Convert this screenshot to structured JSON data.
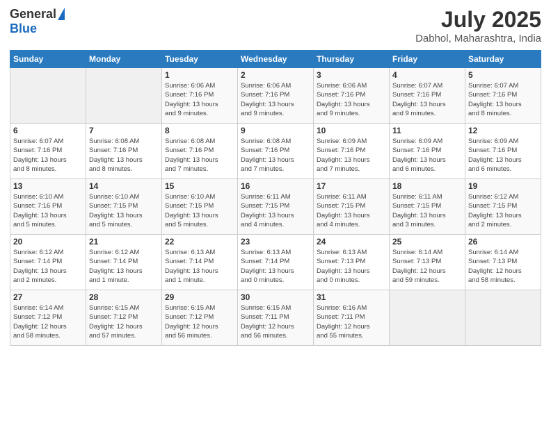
{
  "logo": {
    "general": "General",
    "blue": "Blue"
  },
  "title": "July 2025",
  "subtitle": "Dabhol, Maharashtra, India",
  "days_header": [
    "Sunday",
    "Monday",
    "Tuesday",
    "Wednesday",
    "Thursday",
    "Friday",
    "Saturday"
  ],
  "weeks": [
    [
      {
        "num": "",
        "info": ""
      },
      {
        "num": "",
        "info": ""
      },
      {
        "num": "1",
        "info": "Sunrise: 6:06 AM\nSunset: 7:16 PM\nDaylight: 13 hours\nand 9 minutes."
      },
      {
        "num": "2",
        "info": "Sunrise: 6:06 AM\nSunset: 7:16 PM\nDaylight: 13 hours\nand 9 minutes."
      },
      {
        "num": "3",
        "info": "Sunrise: 6:06 AM\nSunset: 7:16 PM\nDaylight: 13 hours\nand 9 minutes."
      },
      {
        "num": "4",
        "info": "Sunrise: 6:07 AM\nSunset: 7:16 PM\nDaylight: 13 hours\nand 9 minutes."
      },
      {
        "num": "5",
        "info": "Sunrise: 6:07 AM\nSunset: 7:16 PM\nDaylight: 13 hours\nand 8 minutes."
      }
    ],
    [
      {
        "num": "6",
        "info": "Sunrise: 6:07 AM\nSunset: 7:16 PM\nDaylight: 13 hours\nand 8 minutes."
      },
      {
        "num": "7",
        "info": "Sunrise: 6:08 AM\nSunset: 7:16 PM\nDaylight: 13 hours\nand 8 minutes."
      },
      {
        "num": "8",
        "info": "Sunrise: 6:08 AM\nSunset: 7:16 PM\nDaylight: 13 hours\nand 7 minutes."
      },
      {
        "num": "9",
        "info": "Sunrise: 6:08 AM\nSunset: 7:16 PM\nDaylight: 13 hours\nand 7 minutes."
      },
      {
        "num": "10",
        "info": "Sunrise: 6:09 AM\nSunset: 7:16 PM\nDaylight: 13 hours\nand 7 minutes."
      },
      {
        "num": "11",
        "info": "Sunrise: 6:09 AM\nSunset: 7:16 PM\nDaylight: 13 hours\nand 6 minutes."
      },
      {
        "num": "12",
        "info": "Sunrise: 6:09 AM\nSunset: 7:16 PM\nDaylight: 13 hours\nand 6 minutes."
      }
    ],
    [
      {
        "num": "13",
        "info": "Sunrise: 6:10 AM\nSunset: 7:16 PM\nDaylight: 13 hours\nand 5 minutes."
      },
      {
        "num": "14",
        "info": "Sunrise: 6:10 AM\nSunset: 7:15 PM\nDaylight: 13 hours\nand 5 minutes."
      },
      {
        "num": "15",
        "info": "Sunrise: 6:10 AM\nSunset: 7:15 PM\nDaylight: 13 hours\nand 5 minutes."
      },
      {
        "num": "16",
        "info": "Sunrise: 6:11 AM\nSunset: 7:15 PM\nDaylight: 13 hours\nand 4 minutes."
      },
      {
        "num": "17",
        "info": "Sunrise: 6:11 AM\nSunset: 7:15 PM\nDaylight: 13 hours\nand 4 minutes."
      },
      {
        "num": "18",
        "info": "Sunrise: 6:11 AM\nSunset: 7:15 PM\nDaylight: 13 hours\nand 3 minutes."
      },
      {
        "num": "19",
        "info": "Sunrise: 6:12 AM\nSunset: 7:15 PM\nDaylight: 13 hours\nand 2 minutes."
      }
    ],
    [
      {
        "num": "20",
        "info": "Sunrise: 6:12 AM\nSunset: 7:14 PM\nDaylight: 13 hours\nand 2 minutes."
      },
      {
        "num": "21",
        "info": "Sunrise: 6:12 AM\nSunset: 7:14 PM\nDaylight: 13 hours\nand 1 minute."
      },
      {
        "num": "22",
        "info": "Sunrise: 6:13 AM\nSunset: 7:14 PM\nDaylight: 13 hours\nand 1 minute."
      },
      {
        "num": "23",
        "info": "Sunrise: 6:13 AM\nSunset: 7:14 PM\nDaylight: 13 hours\nand 0 minutes."
      },
      {
        "num": "24",
        "info": "Sunrise: 6:13 AM\nSunset: 7:13 PM\nDaylight: 13 hours\nand 0 minutes."
      },
      {
        "num": "25",
        "info": "Sunrise: 6:14 AM\nSunset: 7:13 PM\nDaylight: 12 hours\nand 59 minutes."
      },
      {
        "num": "26",
        "info": "Sunrise: 6:14 AM\nSunset: 7:13 PM\nDaylight: 12 hours\nand 58 minutes."
      }
    ],
    [
      {
        "num": "27",
        "info": "Sunrise: 6:14 AM\nSunset: 7:12 PM\nDaylight: 12 hours\nand 58 minutes."
      },
      {
        "num": "28",
        "info": "Sunrise: 6:15 AM\nSunset: 7:12 PM\nDaylight: 12 hours\nand 57 minutes."
      },
      {
        "num": "29",
        "info": "Sunrise: 6:15 AM\nSunset: 7:12 PM\nDaylight: 12 hours\nand 56 minutes."
      },
      {
        "num": "30",
        "info": "Sunrise: 6:15 AM\nSunset: 7:11 PM\nDaylight: 12 hours\nand 56 minutes."
      },
      {
        "num": "31",
        "info": "Sunrise: 6:16 AM\nSunset: 7:11 PM\nDaylight: 12 hours\nand 55 minutes."
      },
      {
        "num": "",
        "info": ""
      },
      {
        "num": "",
        "info": ""
      }
    ]
  ]
}
